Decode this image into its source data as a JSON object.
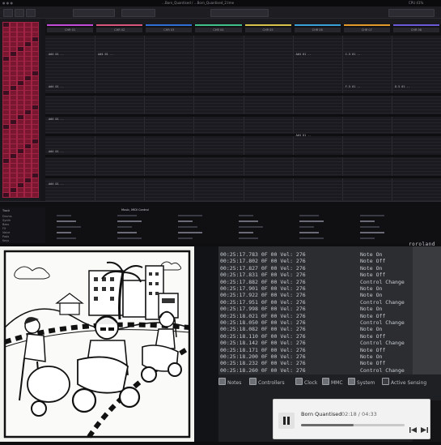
{
  "daw": {
    "window_title": "…Born_Quantised / …Born_Quantised_2.tme",
    "status_right": "CPU 41%",
    "track_names": [
      "CHR 01",
      "CHR 02",
      "CHR 03",
      "CHR 04",
      "CHR 05",
      "CHR 06",
      "CHR 07",
      "CHR 08"
    ],
    "track_colors": [
      "#c44bd8",
      "#d9567f",
      "#2f6fd6",
      "#41c08a",
      "#d7c24b",
      "#3aa0d8",
      "#e39a2b",
      "#6a5ad6"
    ],
    "grid_rows": [
      {
        "cells": [
          "A#4 01 ..",
          "A#4 01 ..",
          "",
          "",
          " ",
          "A#4 01 ..",
          "C-5 01 ..",
          ""
        ]
      },
      {
        "cells": [
          "",
          "",
          "",
          "",
          "",
          "",
          "",
          ""
        ]
      },
      {
        "cells": [
          "A#4 01 ..",
          "",
          "",
          "",
          "",
          "",
          "F-5 01 ..",
          "D-5 01 .."
        ]
      },
      {
        "cells": [
          "",
          "",
          "",
          "",
          "",
          "",
          "",
          ""
        ]
      },
      {
        "cells": [
          "A#4 01 ..",
          "",
          "",
          "",
          "",
          "",
          "",
          ""
        ]
      },
      {
        "cells": [
          "",
          "",
          "",
          "",
          "",
          "A#4 01 ..",
          "",
          ""
        ]
      },
      {
        "cells": [
          "A#4 01 ..",
          "",
          "",
          "",
          "",
          "",
          "",
          ""
        ]
      },
      {
        "cells": [
          "",
          "",
          "",
          "",
          "",
          "",
          "",
          ""
        ]
      },
      {
        "cells": [
          "A#4 01 ..",
          "",
          "",
          "",
          "",
          "",
          "",
          ""
        ]
      }
    ],
    "mixer_label": "Music, MIDI Control",
    "browser_items": [
      "Drums",
      "Synth",
      "Bass",
      "FX",
      "Voice",
      "Pads",
      "Keys"
    ],
    "browser_label": "Track"
  },
  "midi": {
    "logo": "roroland",
    "rows": [
      {
        "time": "00:25:17.783",
        "ch": "0F",
        "num": "00",
        "type": "Vel: 276"
      },
      {
        "time": "00:25:17.802",
        "ch": "0F",
        "num": "00",
        "type": "Vel: 276"
      },
      {
        "time": "00:25:17.827",
        "ch": "0F",
        "num": "00",
        "type": "Vel: 276"
      },
      {
        "time": "00:25:17.831",
        "ch": "0F",
        "num": "00",
        "type": "Vel: 276"
      },
      {
        "time": "00:25:17.882",
        "ch": "0F",
        "num": "00",
        "type": "Vel: 276"
      },
      {
        "time": "00:25:17.901",
        "ch": "0F",
        "num": "00",
        "type": "Vel: 276"
      },
      {
        "time": "00:25:17.922",
        "ch": "0F",
        "num": "00",
        "type": "Vel: 276"
      },
      {
        "time": "00:25:17.951",
        "ch": "0F",
        "num": "00",
        "type": "Vel: 276"
      },
      {
        "time": "00:25:17.998",
        "ch": "0F",
        "num": "00",
        "type": "Vel: 276"
      },
      {
        "time": "00:25:18.021",
        "ch": "0F",
        "num": "00",
        "type": "Vel: 276"
      },
      {
        "time": "00:25:18.050",
        "ch": "0F",
        "num": "00",
        "type": "Vel: 276"
      },
      {
        "time": "00:25:18.082",
        "ch": "0F",
        "num": "00",
        "type": "Vel: 276"
      },
      {
        "time": "00:25:18.110",
        "ch": "0F",
        "num": "00",
        "type": "Vel: 276"
      },
      {
        "time": "00:25:18.142",
        "ch": "0F",
        "num": "00",
        "type": "Vel: 276"
      },
      {
        "time": "00:25:18.171",
        "ch": "0F",
        "num": "00",
        "type": "Vel: 276"
      },
      {
        "time": "00:25:18.200",
        "ch": "0F",
        "num": "00",
        "type": "Vel: 276"
      },
      {
        "time": "00:25:18.232",
        "ch": "0F",
        "num": "00",
        "type": "Vel: 276"
      },
      {
        "time": "00:25:18.260",
        "ch": "0F",
        "num": "00",
        "type": "Vel: 276"
      }
    ],
    "events": [
      "Note On",
      "Note Off",
      "Note On",
      "Note Off",
      "Control Change",
      "Note On",
      "Note On",
      "Control Change",
      "Note On",
      "Note Off",
      "Control Change",
      "Note On",
      "Note Off",
      "Control Change",
      "Note Off",
      "Note On",
      "Note Off",
      "Control Change"
    ],
    "filters": [
      {
        "label": "Notes",
        "checked": true
      },
      {
        "label": "Controllers",
        "checked": true
      },
      {
        "label": "Clock",
        "checked": true
      },
      {
        "label": "MMC",
        "checked": true
      },
      {
        "label": "System",
        "checked": true
      },
      {
        "label": "Active Sensing",
        "checked": false
      }
    ]
  },
  "player": {
    "title": "Born Quantised",
    "elapsed": "02:18",
    "total": "04:33",
    "time_display": "02:18 / 04:33",
    "progress": 0.51,
    "play_state": "playing"
  },
  "colors": {
    "daw_bg": "#16161a",
    "pad_red": "#7a1730",
    "player_bg": "#f2f2f2"
  }
}
